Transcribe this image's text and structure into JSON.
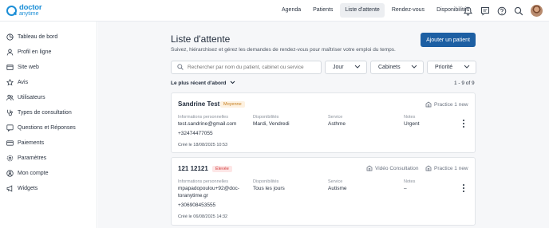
{
  "logo": {
    "line1": "doctor",
    "line2": "anytime"
  },
  "nav": {
    "items": [
      {
        "label": "Agenda",
        "active": false
      },
      {
        "label": "Patients",
        "active": false
      },
      {
        "label": "Liste d'attente",
        "active": true
      },
      {
        "label": "Rendez-vous",
        "active": false
      },
      {
        "label": "Disponibilités",
        "active": false
      }
    ],
    "icons": [
      "bell-icon",
      "chat-icon",
      "help-icon",
      "search-icon",
      "avatar"
    ]
  },
  "sidebar": {
    "items": [
      {
        "label": "Tableau de bord",
        "icon": "dashboard-icon"
      },
      {
        "label": "Profil en ligne",
        "icon": "user-icon"
      },
      {
        "label": "Site web",
        "icon": "globe-icon"
      },
      {
        "label": "Avis",
        "icon": "star-icon"
      },
      {
        "label": "Utilisateurs",
        "icon": "users-icon"
      },
      {
        "label": "Types de consultation",
        "icon": "stethoscope-icon"
      },
      {
        "label": "Questions et Réponses",
        "icon": "qa-icon"
      },
      {
        "label": "Paiements",
        "icon": "card-icon"
      },
      {
        "label": "Paramètres",
        "icon": "gear-icon"
      },
      {
        "label": "Mon compte",
        "icon": "account-icon"
      },
      {
        "label": "Widgets",
        "icon": "megaphone-icon"
      }
    ]
  },
  "main": {
    "title": "Liste d'attente",
    "subtitle": "Suivez, hiérarchisez et gérez les demandes de rendez-vous pour maîtriser votre emploi du temps.",
    "add_button": "Ajouter un patient",
    "search_placeholder": "Rechercher par nom du patient, cabinet ou service",
    "filters": {
      "day": "Jour",
      "cabinets": "Cabinets",
      "priority": "Priorité"
    },
    "sort_label": "Le plus récent d'abord",
    "count": "1 - 9 of 9"
  },
  "columns": {
    "info": "Informations personnelles",
    "availability": "Disponibilités",
    "service": "Service",
    "notes": "Notes"
  },
  "cards": [
    {
      "name": "Sandrine Test",
      "priority": "Moyenne",
      "tags": [
        "Practice 1 new"
      ],
      "email": "test.sandrine@gmail.com",
      "phone": "+32474477055",
      "availability": "Mardi, Vendredi",
      "service": "Asthme",
      "notes": "Urgent",
      "created": "Créé le 18/08/2025 10:53"
    },
    {
      "name": "121 12121",
      "priority": "Élevée",
      "tags": [
        "Vidéo Consultation",
        "Practice 1 new"
      ],
      "email_line1": "mpapadopoulou+92@doc-",
      "email_line2": "toranytime.gr",
      "phone": "+306908453555",
      "availability": "Tous les jours",
      "service": "Autisme",
      "notes": "–",
      "created": "Créé le 06/08/2025 14:32"
    }
  ]
}
